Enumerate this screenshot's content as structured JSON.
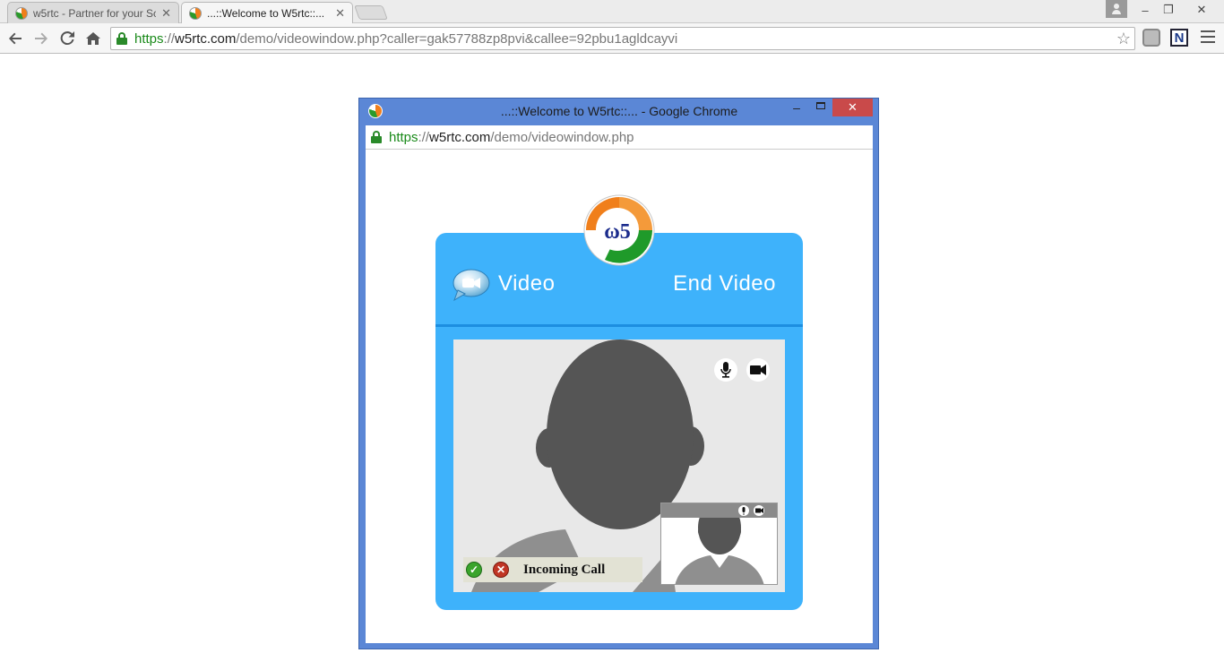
{
  "browser": {
    "tabs": [
      {
        "title": "w5rtc - Partner for your Sc",
        "active": false
      },
      {
        "title": "...::Welcome to W5rtc::...",
        "active": true
      }
    ],
    "omnibox": {
      "scheme": "https",
      "sep": "://",
      "host": "w5rtc.com",
      "path": "/demo/videowindow.php?caller=gak57788zp8pvi&callee=92pbu1agldcayvi"
    }
  },
  "popup": {
    "title": "...::Welcome to W5rtc::... - Google Chrome",
    "address": {
      "scheme": "https",
      "sep": "://",
      "host": "w5rtc.com",
      "path": "/demo/videowindow.php"
    }
  },
  "widget": {
    "logo_text": "ω5",
    "video_label": "Video",
    "end_video_label": "End Video",
    "incoming_label": "Incoming Call"
  },
  "colors": {
    "widget_bg": "#3eb2fb",
    "popup_frame": "#5b87d6",
    "accept": "#3aa42c",
    "reject": "#c03524",
    "logo_orange": "#f07f1b",
    "logo_green": "#1f9a2a",
    "logo_blue": "#1b2b8c"
  }
}
